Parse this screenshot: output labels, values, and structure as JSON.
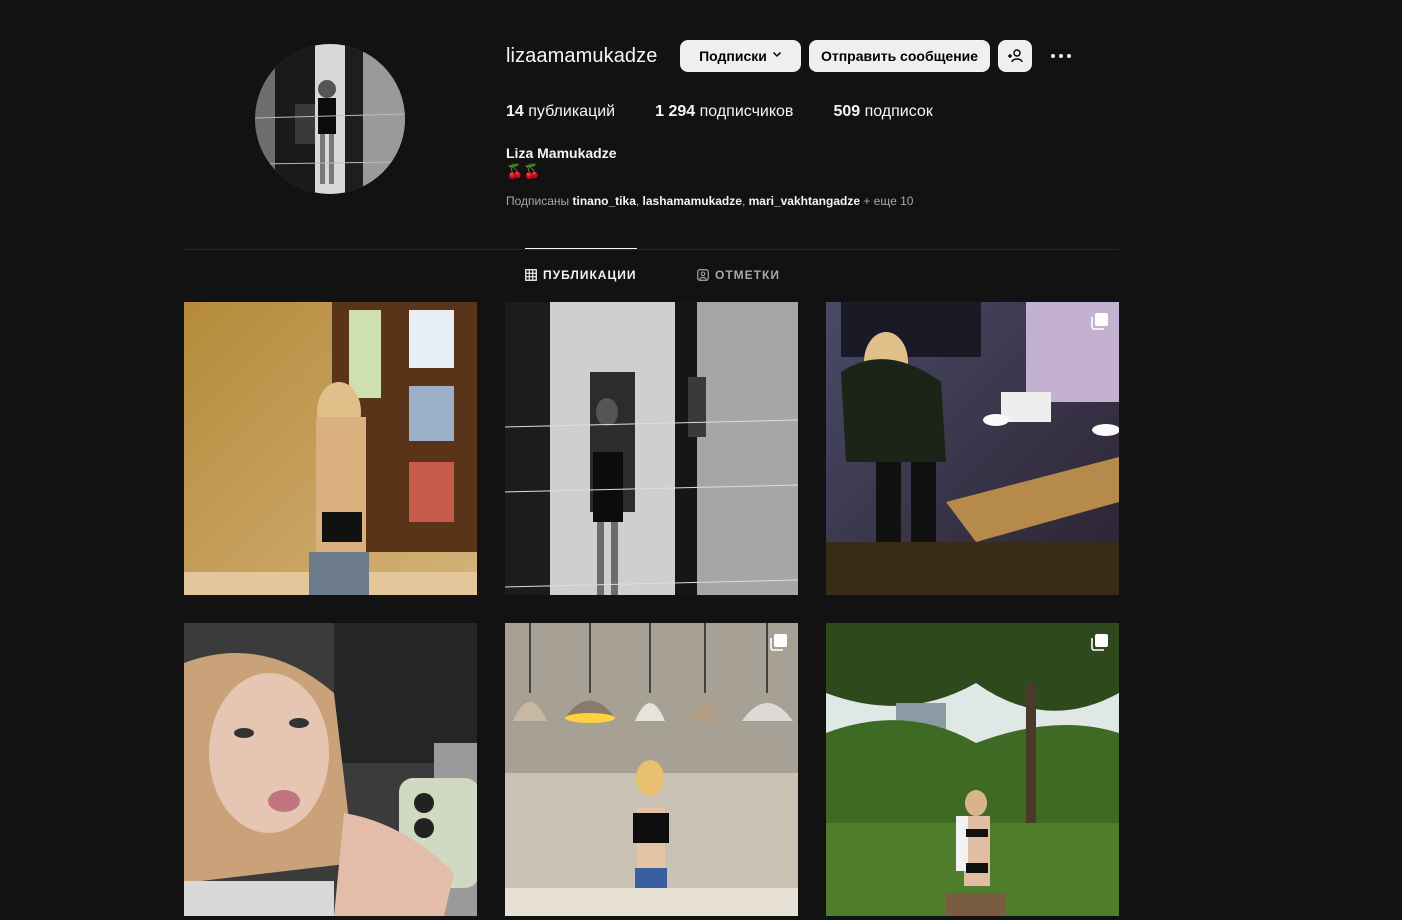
{
  "profile": {
    "username": "lizaamamukadze",
    "full_name": "Liza Mamukadze",
    "bio": "🍒🍒",
    "follow_button": "Подписки",
    "message_button": "Отправить сообщение",
    "suggest_icon": "add-person-icon",
    "more_icon": "more-options-icon"
  },
  "stats": {
    "posts_num": "14",
    "posts_label": "публикаций",
    "followers_num": "1 294",
    "followers_label": "подписчиков",
    "following_num": "509",
    "following_label": "подписок"
  },
  "followed_by": {
    "prefix": "Подписаны",
    "user1": "tinano_tika",
    "user2": "lashamamukadze",
    "user3": "mari_vakhtangadze",
    "suffix": "+ еще 10"
  },
  "tabs": {
    "posts": "ПУБЛИКАЦИИ",
    "tagged": "ОТМЕТКИ"
  },
  "posts": [
    {
      "multi": false
    },
    {
      "multi": false
    },
    {
      "multi": true
    },
    {
      "multi": false
    },
    {
      "multi": true
    },
    {
      "multi": true
    }
  ],
  "colors": {
    "background": "#121212",
    "text": "#f5f5f5",
    "secondary_text": "#a8a8a8",
    "button_bg": "#efefef",
    "divider": "#262626"
  }
}
